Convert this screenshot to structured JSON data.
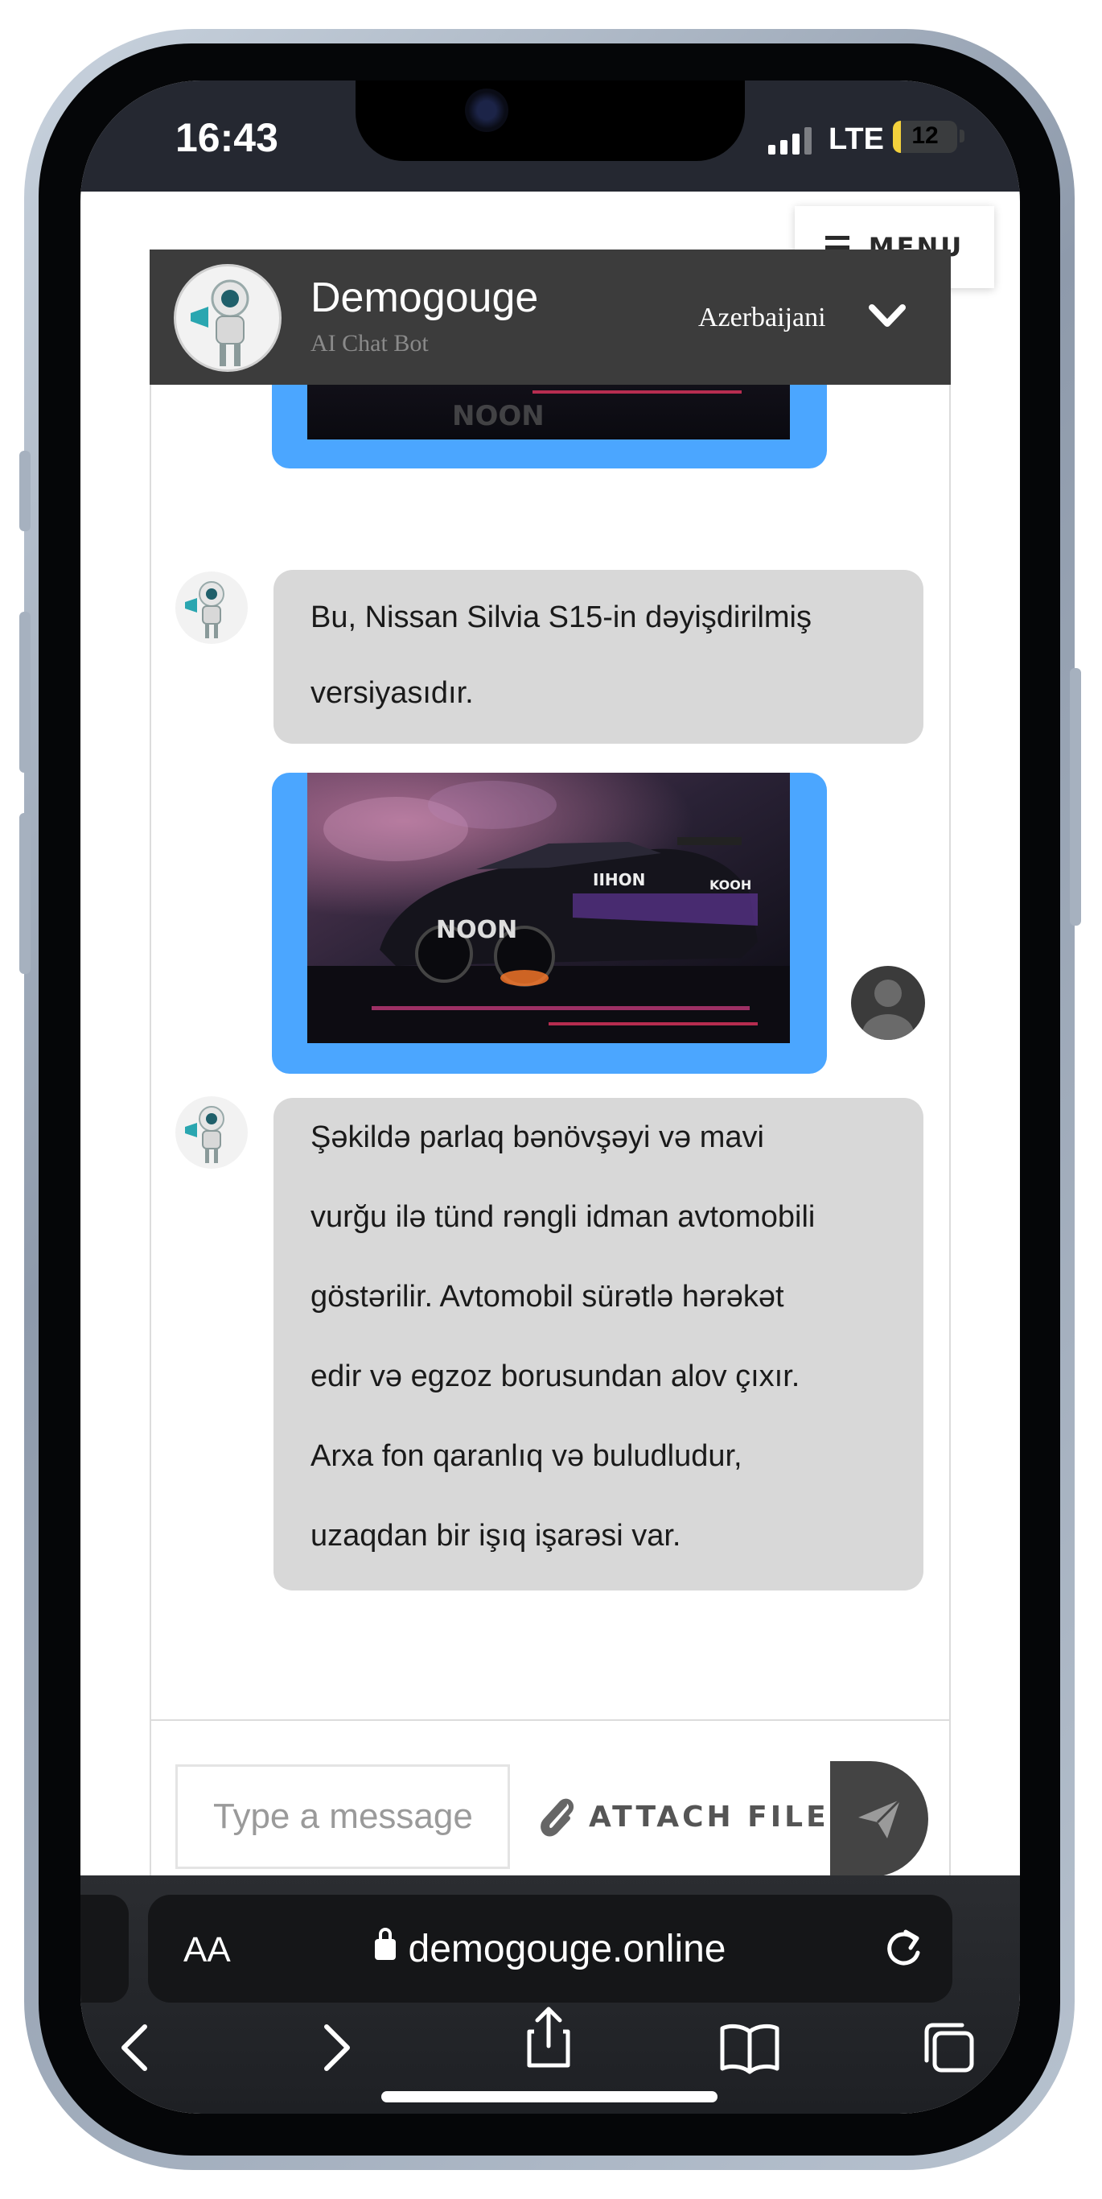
{
  "status_bar": {
    "time": "16:43",
    "network": "LTE",
    "battery": "12",
    "battery_level": 0.12
  },
  "page": {
    "menu_label": "MENU"
  },
  "chat": {
    "bot_name": "Demogouge",
    "bot_subtitle": "AI Chat Bot",
    "language": "Azerbaijani",
    "messages": [
      {
        "role": "user",
        "type": "image",
        "description": "car-image"
      },
      {
        "role": "bot",
        "text": "Bu, Nissan Silvia S15-in dəyişdirilmiş versiyasıdır."
      },
      {
        "role": "user",
        "type": "image",
        "description": "car-image"
      },
      {
        "role": "bot",
        "lines": [
          "Şəkildə parlaq bənövşəyi və mavi",
          "vurğu ilə tünd rəngli idman avtomobili",
          "göstərilir. Avtomobil sürətlə hərəkət",
          "edir və egzoz borusundan alov çıxır.",
          "Arxa fon qaranlıq və buludludur,",
          "uzaqdan bir işıq işarəsi var."
        ]
      }
    ],
    "car_image_labels": {
      "side": "NOON",
      "rear": "IIHON",
      "rear_right": "KOOH"
    },
    "input_placeholder": "Type a message",
    "attach_label": "ATTACH FILE"
  },
  "browser": {
    "aa_label": "AA",
    "url": "demogouge.online"
  },
  "colors": {
    "header": "#3c3c3c",
    "user_bubble": "#4ba6ff",
    "bot_bubble": "#d8d8d8",
    "send": "#444444"
  }
}
